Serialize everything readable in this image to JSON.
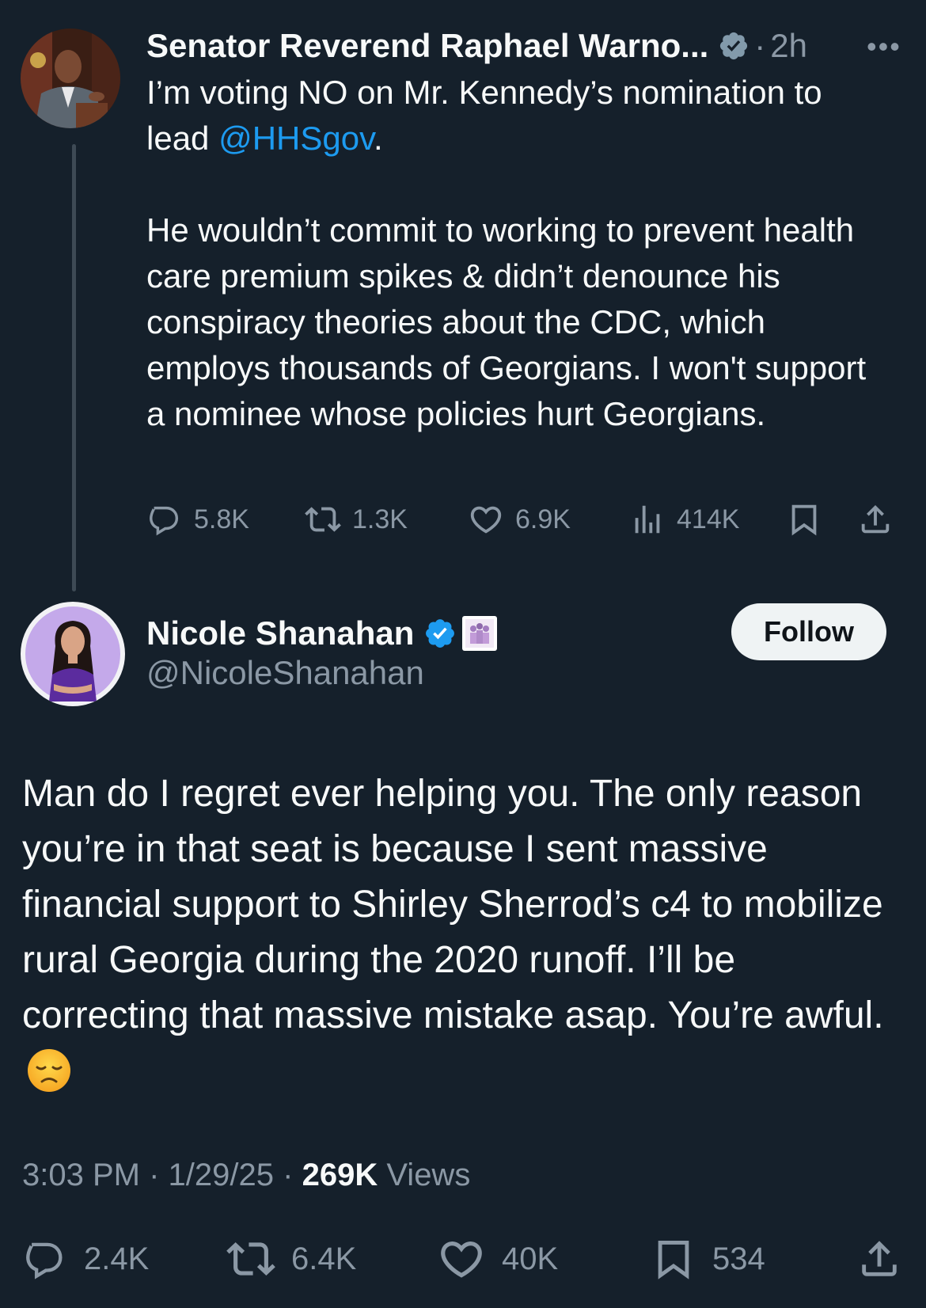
{
  "parent_tweet": {
    "author_name": "Senator Reverend Raphael Warno...",
    "time": "2h",
    "separator": "·",
    "text_before_mention": "I’m voting NO on Mr. Kennedy’s nomination to lead ",
    "mention": "@HHSgov",
    "text_after_mention": ".\n\nHe wouldn’t commit to working to prevent health care premium spikes & didn’t denounce his conspiracy theories about the CDC, which employs thousands of Georgians. I won't support a nominee whose policies hurt Georgians.",
    "stats": {
      "replies": "5.8K",
      "retweets": "1.3K",
      "likes": "6.9K",
      "views": "414K"
    }
  },
  "reply_tweet": {
    "author_name": "Nicole Shanahan",
    "handle": "@NicoleShanahan",
    "follow_label": "Follow",
    "text": "Man do I regret ever helping you. The only reason you’re in that seat is because I sent massive financial support to Shirley Sherrod’s c4 to mobilize rural Georgia during the 2020 runoff. I’ll be correcting that massive mistake asap. You’re awful.",
    "emoji": "😞",
    "time": "3:03 PM",
    "date": "1/29/25",
    "views_count": "269K",
    "views_label": "Views",
    "separator": "·",
    "stats": {
      "replies": "2.4K",
      "retweets": "6.4K",
      "likes": "40K",
      "bookmarks": "534"
    }
  },
  "colors": {
    "background": "#15202b",
    "text_primary": "#f7f9f9",
    "text_secondary": "#8b98a5",
    "link": "#1d9bf0",
    "verified_blue": "#1d9bf0",
    "verified_gray": "#829aab"
  },
  "icons": [
    "more-icon",
    "reply-icon",
    "retweet-icon",
    "like-icon",
    "views-icon",
    "bookmark-icon",
    "share-icon",
    "verified-icon",
    "affiliate-badge-icon"
  ]
}
